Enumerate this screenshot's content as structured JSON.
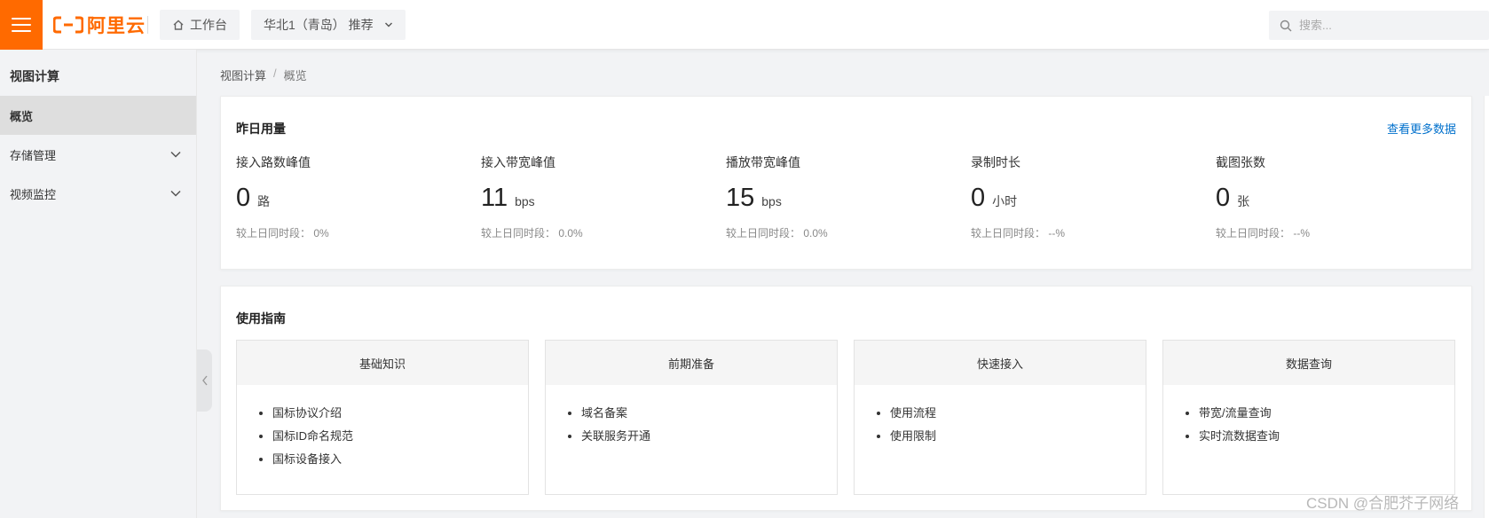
{
  "header": {
    "logo_text": "阿里云",
    "workbench_label": "工作台",
    "region_label": "华北1（青岛） 推荐",
    "search_placeholder": "搜索...",
    "brand_color": "#ff6a00"
  },
  "sidebar": {
    "title": "视图计算",
    "items": [
      {
        "label": "概览",
        "active": true
      },
      {
        "label": "存储管理",
        "expandable": true
      },
      {
        "label": "视频监控",
        "expandable": true
      }
    ]
  },
  "breadcrumb": {
    "root": "视图计算",
    "separator": "/",
    "current": "概览"
  },
  "usage": {
    "title": "昨日用量",
    "more_link": "查看更多数据",
    "metrics": [
      {
        "label": "接入路数峰值",
        "value": "0",
        "unit": "路",
        "compare": "较上日同时段：  0%"
      },
      {
        "label": "接入带宽峰值",
        "value": "11",
        "unit": "bps",
        "compare": "较上日同时段：  0.0%"
      },
      {
        "label": "播放带宽峰值",
        "value": "15",
        "unit": "bps",
        "compare": "较上日同时段：  0.0%"
      },
      {
        "label": "录制时长",
        "value": "0",
        "unit": "小时",
        "compare": "较上日同时段：  --%"
      },
      {
        "label": "截图张数",
        "value": "0",
        "unit": "张",
        "compare": "较上日同时段：  --%"
      }
    ]
  },
  "guide": {
    "title": "使用指南",
    "sections": [
      {
        "title": "基础知识",
        "links": [
          "国标协议介绍",
          "国标ID命名规范",
          "国标设备接入"
        ]
      },
      {
        "title": "前期准备",
        "links": [
          "域名备案",
          "关联服务开通"
        ]
      },
      {
        "title": "快速接入",
        "links": [
          "使用流程",
          "使用限制"
        ]
      },
      {
        "title": "数据查询",
        "links": [
          "带宽/流量查询",
          "实时流数据查询"
        ]
      }
    ]
  },
  "watermark": "CSDN @合肥芥子网络"
}
